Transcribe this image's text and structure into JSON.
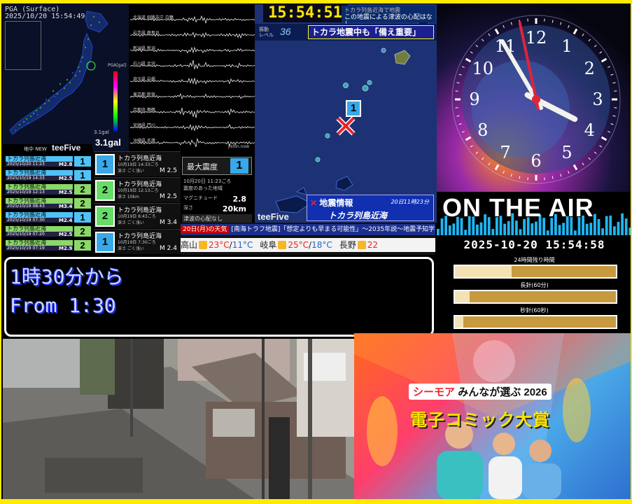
{
  "pga": {
    "title": "PGA (Surface)",
    "timestamp": "2025/10/20 15:54:49",
    "unit_label": "PGA[gal]",
    "gal_small": "3.1gal",
    "gal_value": "3.1gal",
    "teefive": "teeFive",
    "list_header": "地中 NEW"
  },
  "seismo": {
    "stations": [
      "北海道 釧路支庁 白糠",
      "岩手県 鹿島台",
      "新潟県 新潟",
      "石川県 金沢",
      "埼玉県 岩槻",
      "東京都 新宿",
      "京都府 舞鶴",
      "宮崎県 門川",
      "沖縄県 名護"
    ],
    "footer": "jishin.now"
  },
  "quakes": [
    {
      "place": "トカラ列島近海",
      "date": "2025/10/20 11:23",
      "mag": "M2.8",
      "shindo": "1",
      "color": "#4fc3f7"
    },
    {
      "place": "トカラ列島近海",
      "date": "2025/10/19 14:33",
      "mag": "M2.5",
      "shindo": "1",
      "color": "#4fc3f7"
    },
    {
      "place": "トカラ列島近海",
      "date": "2025/10/19 12:13",
      "mag": "M2.5",
      "shindo": "2",
      "color": "#8bd86b"
    },
    {
      "place": "トカラ列島近海",
      "date": "2025/10/19 08:43",
      "mag": "M3.4",
      "shindo": "2",
      "color": "#8bd86b"
    },
    {
      "place": "トカラ列島近海",
      "date": "2025/10/19 07:30",
      "mag": "M2.4",
      "shindo": "1",
      "color": "#4fc3f7"
    },
    {
      "place": "トカラ列島近海",
      "date": "2025/10/19 07:20",
      "mag": "M2.5",
      "shindo": "2",
      "color": "#8bd86b"
    },
    {
      "place": "トカラ列島近海",
      "date": "2025/10/19 07:19",
      "mag": "M2.9",
      "shindo": "2",
      "color": "#8bd86b"
    }
  ],
  "cards": [
    {
      "badge": "1",
      "place": "トカラ列島近海",
      "when": "10月19日 14:33ごろ",
      "depth": "深さ ごく浅い",
      "mag": "M 2.5"
    },
    {
      "badge": "2",
      "place": "トカラ列島近海",
      "when": "10月19日 12:13ごろ",
      "depth": "深さ 10km",
      "mag": "M 2.5"
    },
    {
      "badge": "2",
      "place": "トカラ列島近海",
      "when": "10月19日 8:43ごろ",
      "depth": "深さ ごく浅い",
      "mag": "M 3.4"
    },
    {
      "badge": "1",
      "place": "トカラ列島近海",
      "when": "10月19日 7:30ごろ",
      "depth": "深さ ごく浅い",
      "mag": "M 2.4"
    }
  ],
  "maxint": {
    "label": "最大震度",
    "value": "1",
    "when": "10月20日 11:23ごろ",
    "note": "震度のあった地域",
    "mag_label": "マグニチュード",
    "mag_value": "2.8",
    "depth_label": "深さ",
    "depth_value": "20km",
    "tsunami": "津波の心配なし"
  },
  "map": {
    "clock": "15:54:51",
    "notice_top": "トカラ列島近海で地震",
    "notice": "この地震による津波の心配はなし",
    "level_label1": "振動",
    "level_label2": "レベル",
    "level": "36",
    "banner": "トカラ地震中も「備え重要」",
    "marker": "1",
    "eq_title": "地震情報",
    "eq_time": "20日11時23分",
    "eq_place": "トカラ列島近海",
    "teefive": "teeFive"
  },
  "ticker": {
    "tag": "20日(月)の天気",
    "headline": "[南海トラフ地震]「想定よりも早まる可能性」～2035年説～地震予知学会",
    "weather": [
      {
        "city": "高山",
        "hi": "23°C",
        "lo": "11°C"
      },
      {
        "city": "岐阜",
        "hi": "25°C",
        "lo": "18°C"
      },
      {
        "city": "長野",
        "hi": "22",
        "lo": ""
      }
    ]
  },
  "clock": {
    "numerals": [
      "12",
      "1",
      "2",
      "3",
      "4",
      "5",
      "6",
      "7",
      "8",
      "9",
      "10",
      "11"
    ],
    "time": "15:54:58"
  },
  "onair": {
    "text": "ON THE AIR",
    "datetime": "2025-10-20 15:54:58"
  },
  "progress": [
    {
      "label": "24時間残り時間",
      "fraction": 0.35
    },
    {
      "label": "長針(60分)",
      "fraction": 0.09
    },
    {
      "label": "秒針(60秒)",
      "fraction": 0.05
    }
  ],
  "message": {
    "line1": "1時30分から",
    "line2": "From 1:30"
  },
  "ad": {
    "brand": "シーモア",
    "prefix": "みんなが選ぶ",
    "year": "2026",
    "title": "電子コミック大賞"
  },
  "colors": {
    "frame": "#ffea00",
    "intensity1": "#38a8e8",
    "intensity2": "#6ddd6d"
  }
}
